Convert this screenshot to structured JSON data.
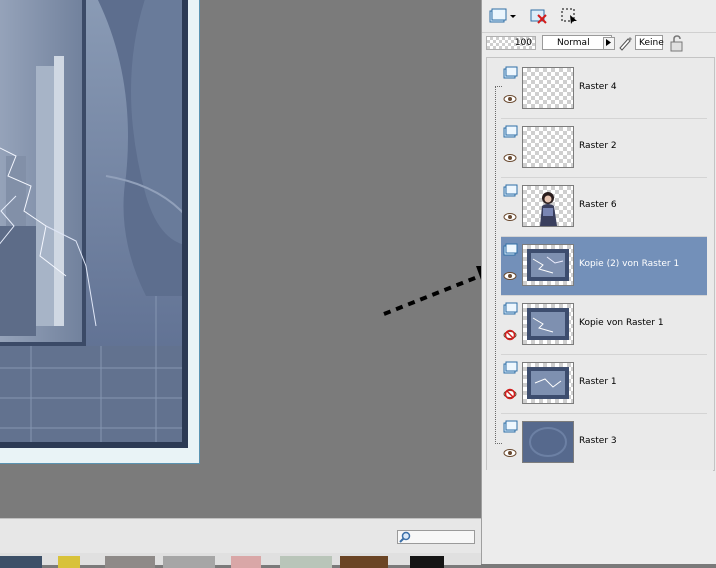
{
  "palette": {
    "opacity_value": "100",
    "blend_mode": "Normal",
    "mask_value": "Keine"
  },
  "layers": [
    {
      "name": "Raster 4",
      "visible": true,
      "selected": false,
      "thumb": "transparent"
    },
    {
      "name": "Raster 2",
      "visible": true,
      "selected": false,
      "thumb": "transparent"
    },
    {
      "name": "Raster 6",
      "visible": true,
      "selected": false,
      "thumb": "figure"
    },
    {
      "name": "Kopie (2) von Raster 1",
      "visible": true,
      "selected": true,
      "thumb": "storm"
    },
    {
      "name": "Kopie von Raster 1",
      "visible": false,
      "selected": false,
      "thumb": "storm"
    },
    {
      "name": "Raster 1",
      "visible": false,
      "selected": false,
      "thumb": "storm"
    },
    {
      "name": "Raster 3",
      "visible": true,
      "selected": false,
      "thumb": "blue"
    }
  ],
  "colors": {
    "selected_row": "#7390b9",
    "workspace": "#7b7b7b",
    "canvas_frame": "#5a93b1"
  },
  "icons": {
    "toolbar": [
      "new-layer-icon",
      "delete-layer-icon",
      "selection-icon"
    ],
    "row_visibility": "layer-type-icon",
    "eye": "eye-icon",
    "eye_off": "eye-hidden-icon"
  }
}
